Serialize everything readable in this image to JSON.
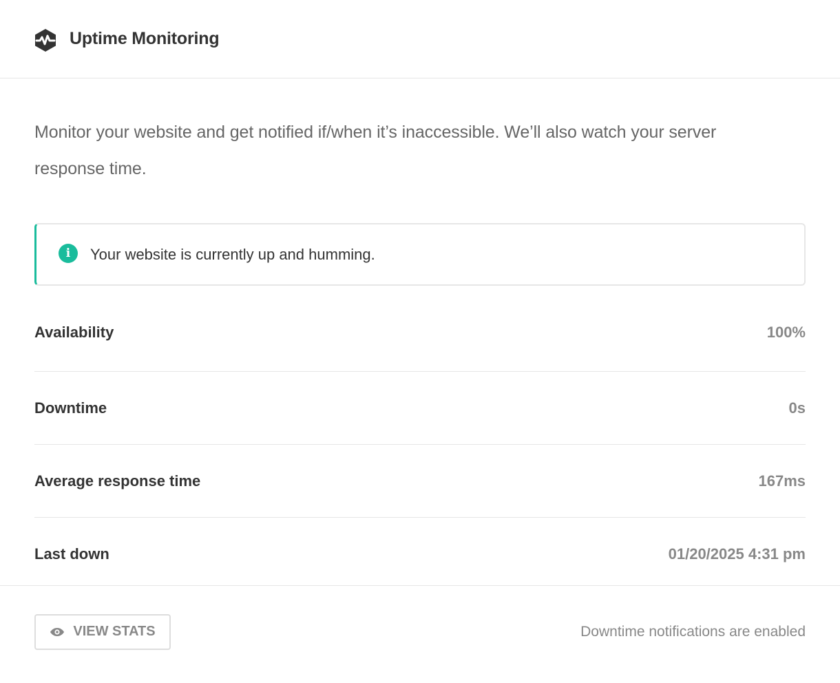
{
  "header": {
    "title": "Uptime Monitoring",
    "icon": "uptime-logo-icon"
  },
  "description": "Monitor your website and get notified if/when it’s inaccessible. We’ll also watch your server response time.",
  "notice": {
    "icon": "info-icon",
    "icon_glyph": "i",
    "text": "Your website is currently up and humming.",
    "accent_color": "#1abc9c"
  },
  "stats": [
    {
      "label": "Availability",
      "value": "100%"
    },
    {
      "label": "Downtime",
      "value": "0s"
    },
    {
      "label": "Average response time",
      "value": "167ms"
    },
    {
      "label": "Last down",
      "value": "01/20/2025 4:31 pm"
    }
  ],
  "footer": {
    "view_stats_label": "VIEW STATS",
    "view_stats_icon": "eye-icon",
    "notifications_text": "Downtime notifications are enabled"
  }
}
